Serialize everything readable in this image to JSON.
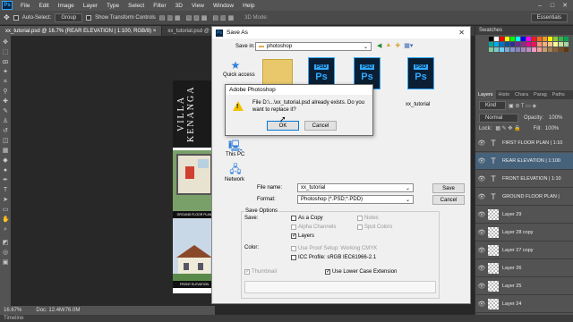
{
  "app": {
    "logo": "Ps"
  },
  "menu": [
    "File",
    "Edit",
    "Image",
    "Layer",
    "Type",
    "Select",
    "Filter",
    "3D",
    "View",
    "Window",
    "Help"
  ],
  "options_bar": {
    "auto_select_label": "Auto-Select:",
    "auto_select_value": "Group",
    "show_transform_label": "Show Transform Controls",
    "mode_3d": "3D Mode:",
    "workspace": "Essentials"
  },
  "doc_tabs": [
    "xx_tutorial.psd @ 16.7% (REAR ELEVATION | 1:100, RGB/8)",
    "xx_tutorial.psd @ 50% (GROUND"
  ],
  "status_bar": {
    "zoom": "16.67%",
    "doc": "Doc: 12.4M/76.0M"
  },
  "timeline_label": "Timeline",
  "artwork": {
    "title": "VILLA KENANGA",
    "ground_floor_caption": "GROUND FLOOR PLAN",
    "front_elevation_caption": "FRONT ELEVATION"
  },
  "swatches_panel": {
    "title": "Swatches",
    "colors": [
      "#000000",
      "#ffffff",
      "#ff0000",
      "#ffff00",
      "#00ff00",
      "#00ffff",
      "#0000ff",
      "#ff00ff",
      "#ed1c24",
      "#f26522",
      "#f7941d",
      "#fff200",
      "#8dc63f",
      "#39b54a",
      "#00a651",
      "#00a99d",
      "#00aeef",
      "#0072bc",
      "#0054a6",
      "#2e3192",
      "#662d91",
      "#92278f",
      "#ec008c",
      "#ed145b",
      "#f69679",
      "#fbad7b",
      "#fdc689",
      "#fff799",
      "#c4df9b",
      "#a3d39c",
      "#82ca9c",
      "#7accc8",
      "#6dcff6",
      "#7da7d9",
      "#8393ca",
      "#8781bd",
      "#a186be",
      "#bd8cbf",
      "#f49ac1",
      "#f5989d",
      "#c69c6d",
      "#a67c52",
      "#8c6239",
      "#754c24",
      "#603913"
    ]
  },
  "layers_panel": {
    "tabs": [
      "Layers",
      "Histo",
      "Chara",
      "Parag",
      "Paths"
    ],
    "kind": "Kind",
    "blend_mode": "Normal",
    "opacity_label": "Opacity:",
    "opacity_value": "100%",
    "lock_label": "Lock:",
    "fill_label": "Fill:",
    "fill_value": "100%",
    "layers": [
      {
        "name": "FIRST FLOOR PLAN | 1:10",
        "type": "text",
        "selected": false
      },
      {
        "name": "REAR ELEVATION | 1:100",
        "type": "text",
        "selected": true
      },
      {
        "name": "FRONT ELEVATION | 1:10",
        "type": "text",
        "selected": false
      },
      {
        "name": "GROUND FLOOR PLAN |",
        "type": "text",
        "selected": false
      },
      {
        "name": "Layer 29",
        "type": "pixel",
        "selected": false
      },
      {
        "name": "Layer 28 copy",
        "type": "pixel",
        "selected": false
      },
      {
        "name": "Layer 27 copy",
        "type": "pixel",
        "selected": false
      },
      {
        "name": "Layer 26",
        "type": "pixel",
        "selected": false
      },
      {
        "name": "Layer 25",
        "type": "pixel",
        "selected": false
      },
      {
        "name": "Layer 24",
        "type": "pixel",
        "selected": false
      }
    ]
  },
  "save_dialog": {
    "title": "Save As",
    "save_in_label": "Save in:",
    "save_in_value": "photoshop",
    "nav": {
      "quick_access": "Quick access",
      "this_pc": "This PC",
      "network": "Network"
    },
    "files": [
      {
        "tag": "PSD",
        "name": ""
      },
      {
        "tag": "PSD",
        "name": ""
      },
      {
        "tag": "PSD",
        "name": ""
      },
      {
        "tag": "PSD",
        "name": "xx_tutorial"
      }
    ],
    "file_name_label": "File name:",
    "file_name_value": "xx_tutorial",
    "format_label": "Format:",
    "format_value": "Photoshop (*.PSD;*.PDD)",
    "save_button": "Save",
    "cancel_button": "Cancel",
    "save_options_title": "Save Options",
    "save_label": "Save:",
    "as_a_copy": "As a Copy",
    "notes": "Notes",
    "alpha_channels": "Alpha Channels",
    "spot_colors": "Spot Colors",
    "layers": "Layers",
    "color_label": "Color:",
    "use_proof_setup": "Use Proof Setup:  Working CMYK",
    "icc_profile": "ICC Profile:  sRGB IEC61966-2.1",
    "thumbnail": "Thumbnail",
    "lower_case_ext": "Use Lower Case Extension"
  },
  "alert": {
    "title": "Adobe Photoshop",
    "message_line1": "File D:\\...\\xx_tutorial.psd already exists.  Do you",
    "message_line2": "want to replace it?",
    "ok_button": "OK",
    "cancel_button": "Cancel"
  }
}
